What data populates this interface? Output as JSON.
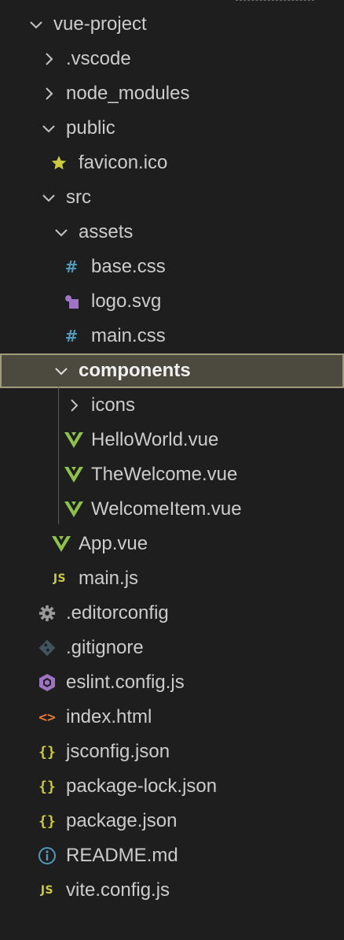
{
  "explorer": {
    "tree": [
      {
        "key": "vue-project",
        "label": "vue-project",
        "type": "folder",
        "expanded": true,
        "depth": 0
      },
      {
        "key": "vscode",
        "label": ".vscode",
        "type": "folder",
        "expanded": false,
        "depth": 1
      },
      {
        "key": "node_modules",
        "label": "node_modules",
        "type": "folder",
        "expanded": false,
        "depth": 1
      },
      {
        "key": "public",
        "label": "public",
        "type": "folder",
        "expanded": true,
        "depth": 1
      },
      {
        "key": "favicon",
        "label": "favicon.ico",
        "type": "file",
        "icon": "star-icon",
        "depth": 2
      },
      {
        "key": "src",
        "label": "src",
        "type": "folder",
        "expanded": true,
        "depth": 1
      },
      {
        "key": "assets",
        "label": "assets",
        "type": "folder",
        "expanded": true,
        "depth": 2
      },
      {
        "key": "base_css",
        "label": "base.css",
        "type": "file",
        "icon": "css-hash-icon",
        "depth": 3
      },
      {
        "key": "logo_svg",
        "label": "logo.svg",
        "type": "file",
        "icon": "svg-shapes-icon",
        "depth": 3
      },
      {
        "key": "main_css",
        "label": "main.css",
        "type": "file",
        "icon": "css-hash-icon",
        "depth": 3
      },
      {
        "key": "components",
        "label": "components",
        "type": "folder",
        "expanded": true,
        "selected": true,
        "depth": 2
      },
      {
        "key": "icons",
        "label": "icons",
        "type": "folder",
        "expanded": false,
        "depth": 3
      },
      {
        "key": "helloworld",
        "label": "HelloWorld.vue",
        "type": "file",
        "icon": "vue-icon",
        "depth": 3
      },
      {
        "key": "thewelcome",
        "label": "TheWelcome.vue",
        "type": "file",
        "icon": "vue-icon",
        "depth": 3
      },
      {
        "key": "welcomeitem",
        "label": "WelcomeItem.vue",
        "type": "file",
        "icon": "vue-icon",
        "depth": 3
      },
      {
        "key": "app_vue",
        "label": "App.vue",
        "type": "file",
        "icon": "vue-icon",
        "depth": 2
      },
      {
        "key": "main_js",
        "label": "main.js",
        "type": "file",
        "icon": "js-icon",
        "depth": 2
      },
      {
        "key": "editorconfig",
        "label": ".editorconfig",
        "type": "file",
        "icon": "gear-icon",
        "depth": 1
      },
      {
        "key": "gitignore",
        "label": ".gitignore",
        "type": "file",
        "icon": "git-icon",
        "depth": 1
      },
      {
        "key": "eslint",
        "label": "eslint.config.js",
        "type": "file",
        "icon": "eslint-icon",
        "depth": 1
      },
      {
        "key": "index_html",
        "label": "index.html",
        "type": "file",
        "icon": "html-icon",
        "depth": 1
      },
      {
        "key": "jsconfig",
        "label": "jsconfig.json",
        "type": "file",
        "icon": "json-icon",
        "depth": 1
      },
      {
        "key": "package_lock",
        "label": "package-lock.json",
        "type": "file",
        "icon": "json-icon",
        "depth": 1
      },
      {
        "key": "package_json",
        "label": "package.json",
        "type": "file",
        "icon": "json-icon",
        "depth": 1
      },
      {
        "key": "readme",
        "label": "README.md",
        "type": "file",
        "icon": "info-icon",
        "depth": 1
      },
      {
        "key": "vite_config",
        "label": "vite.config.js",
        "type": "file",
        "icon": "js-icon",
        "depth": 1
      }
    ]
  },
  "icons": {
    "js_text": "JS",
    "hash_text": "#",
    "braces_text": "{}",
    "angle_text": "<>"
  },
  "colors": {
    "background": "#1e1e1e",
    "selected_bg": "#4c4a3f",
    "selected_border": "#9f9a7c",
    "vue_green": "#8dc149",
    "css_blue": "#519aba",
    "js_yellow": "#cbcb41",
    "svg_purple": "#a074c4",
    "html_orange": "#e37933",
    "info_blue": "#519aba"
  }
}
